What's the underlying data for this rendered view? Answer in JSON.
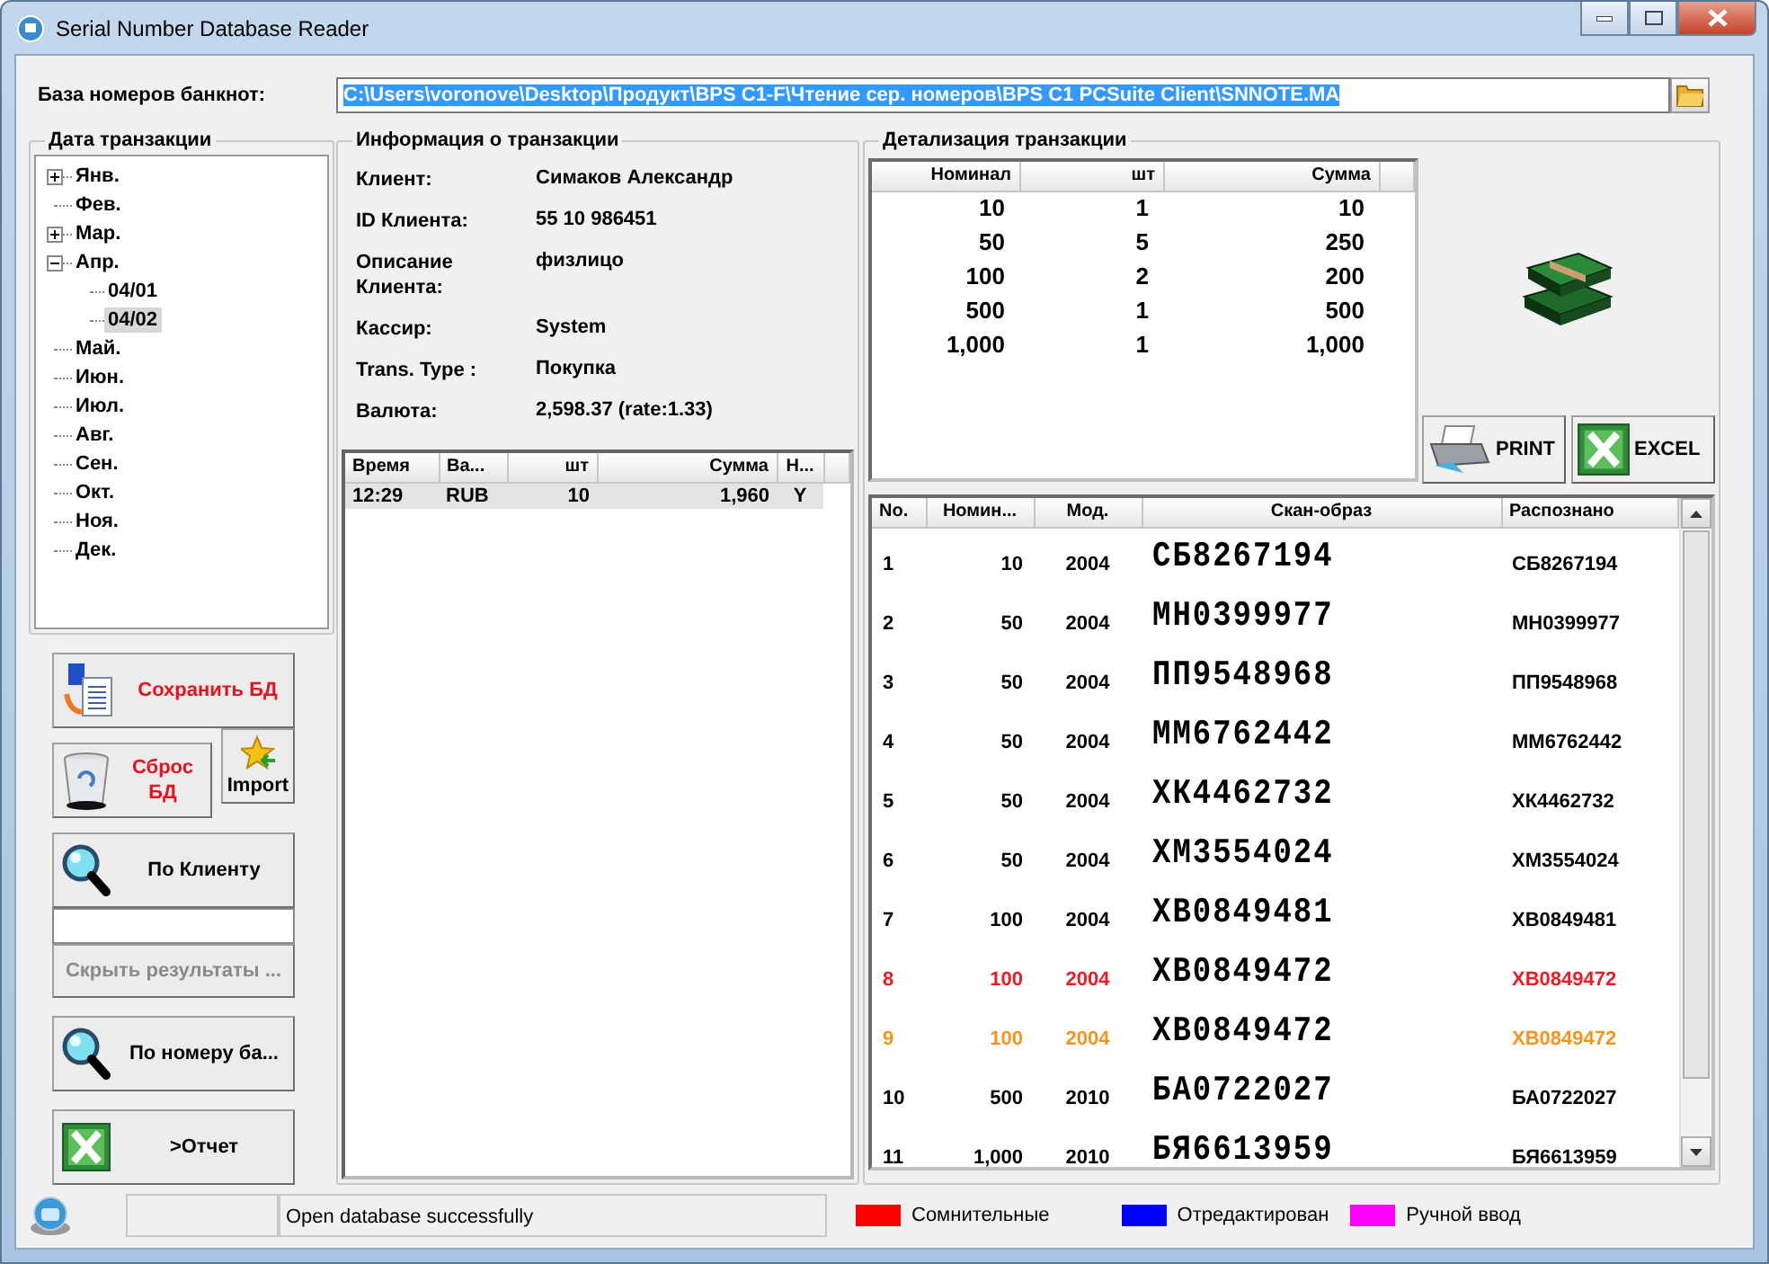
{
  "window": {
    "title": "Serial Number Database Reader"
  },
  "database": {
    "label": "База номеров банкнот:",
    "path": "C:\\Users\\voronove\\Desktop\\Продукт\\BPS C1-F\\Чтение сер. номеров\\BPS C1 PCSuite Client\\SNNOTE.MA",
    "highlighted": true
  },
  "date_panel": {
    "title": "Дата транзакции",
    "months": [
      {
        "label": "Янв.",
        "kind": "collapsed",
        "selected": false
      },
      {
        "label": "Фев.",
        "kind": "leaf",
        "selected": false
      },
      {
        "label": "Мар.",
        "kind": "collapsed",
        "selected": false
      },
      {
        "label": "Апр.",
        "kind": "expanded",
        "selected": false,
        "children": [
          {
            "label": "04/01",
            "selected": false
          },
          {
            "label": "04/02",
            "selected": true
          }
        ]
      },
      {
        "label": "Май.",
        "kind": "leaf",
        "selected": false
      },
      {
        "label": "Июн.",
        "kind": "leaf",
        "selected": false
      },
      {
        "label": "Июл.",
        "kind": "leaf",
        "selected": false
      },
      {
        "label": "Авг.",
        "kind": "leaf",
        "selected": false
      },
      {
        "label": "Сен.",
        "kind": "leaf",
        "selected": false
      },
      {
        "label": "Окт.",
        "kind": "leaf",
        "selected": false
      },
      {
        "label": "Ноя.",
        "kind": "leaf",
        "selected": false
      },
      {
        "label": "Дек.",
        "kind": "leaf",
        "selected": false
      }
    ]
  },
  "actions": [
    {
      "label": "Сохранить БД",
      "kind": "save",
      "alert": true,
      "disabled": false
    },
    {
      "label": "Сброс БД",
      "kind": "reset",
      "alert": true,
      "disabled": false
    },
    {
      "label": "Import",
      "kind": "import",
      "alert": false,
      "disabled": false
    },
    {
      "label": "По Клиенту",
      "kind": "search",
      "alert": false,
      "disabled": false
    },
    {
      "kind": "field"
    },
    {
      "label": "Скрыть результаты ...",
      "kind": "hide",
      "alert": false,
      "disabled": true
    },
    {
      "label": "По номеру ба...",
      "kind": "search",
      "alert": false,
      "disabled": false
    },
    {
      "label": ">Отчет",
      "kind": "excel",
      "alert": false,
      "disabled": false
    }
  ],
  "info_panel": {
    "title": "Информация о транзакции",
    "fields": [
      {
        "label": "Клиент:",
        "value": "Симаков Александр"
      },
      {
        "label": "ID Клиента:",
        "value": "55 10 986451"
      },
      {
        "label": "Описание Клиента:",
        "value": "физлицо"
      },
      {
        "label": "Кассир:",
        "value": "System"
      },
      {
        "label": "Trans. Type :",
        "value": "Покупка"
      },
      {
        "label": "Валюта:",
        "value": "2,598.37 (rate:1.33)"
      }
    ],
    "table": {
      "columns": [
        "Время",
        "Ва...",
        "шт",
        "Сумма",
        "Н..."
      ],
      "rows": [
        {
          "cells": [
            "12:29",
            "RUB",
            "10",
            "1,960",
            "Y"
          ],
          "selected": true
        }
      ]
    }
  },
  "detail_panel": {
    "title": "Детализация транзакции",
    "columns": [
      "Номинал",
      "шт",
      "Сумма"
    ],
    "rows": [
      [
        "10",
        "1",
        "10"
      ],
      [
        "50",
        "5",
        "250"
      ],
      [
        "100",
        "2",
        "200"
      ],
      [
        "500",
        "1",
        "500"
      ],
      [
        "1,000",
        "1",
        "1,000"
      ]
    ],
    "buttons": [
      {
        "label": "PRINT",
        "kind": "print"
      },
      {
        "label": "EXCEL",
        "kind": "excel"
      }
    ]
  },
  "serials": {
    "columns": [
      "No.",
      "Номин...",
      "Мод.",
      "Скан-образ",
      "Распознано"
    ],
    "rows": [
      {
        "no": "1",
        "denomination": "10",
        "model": "2004",
        "scan": "СБ8267194",
        "recognized": "СБ8267194",
        "color": "#000000"
      },
      {
        "no": "2",
        "denomination": "50",
        "model": "2004",
        "scan": "МН0399977",
        "recognized": "МН0399977",
        "color": "#000000"
      },
      {
        "no": "3",
        "denomination": "50",
        "model": "2004",
        "scan": "ПП9548968",
        "recognized": "ПП9548968",
        "color": "#000000"
      },
      {
        "no": "4",
        "denomination": "50",
        "model": "2004",
        "scan": "ММ6762442",
        "recognized": "ММ6762442",
        "color": "#000000"
      },
      {
        "no": "5",
        "denomination": "50",
        "model": "2004",
        "scan": "ХК4462732",
        "recognized": "ХК4462732",
        "color": "#000000"
      },
      {
        "no": "6",
        "denomination": "50",
        "model": "2004",
        "scan": "ХМ3554024",
        "recognized": "ХМ3554024",
        "color": "#000000"
      },
      {
        "no": "7",
        "denomination": "100",
        "model": "2004",
        "scan": "ХВ0849481",
        "recognized": "ХВ0849481",
        "color": "#000000"
      },
      {
        "no": "8",
        "denomination": "100",
        "model": "2004",
        "scan": "ХВ0849472",
        "recognized": "ХВ0849472",
        "color": "#ee1c24"
      },
      {
        "no": "9",
        "denomination": "100",
        "model": "2004",
        "scan": "ХВ0849472",
        "recognized": "ХВ0849472",
        "color": "#f7941d"
      },
      {
        "no": "10",
        "denomination": "500",
        "model": "2010",
        "scan": "БА0722027",
        "recognized": "БА0722027",
        "color": "#000000"
      },
      {
        "no": "11",
        "denomination": "1,000",
        "model": "2010",
        "scan": "БЯ6613959",
        "recognized": "БЯ6613959",
        "color": "#000000"
      }
    ]
  },
  "status_bar": {
    "message": "Open database successfully"
  },
  "legend": [
    {
      "label": "Сомнительные",
      "color": "#ff0000"
    },
    {
      "label": "Отредактирован",
      "color": "#0000ff"
    },
    {
      "label": "Ручной ввод",
      "color": "#ff00ff"
    }
  ]
}
